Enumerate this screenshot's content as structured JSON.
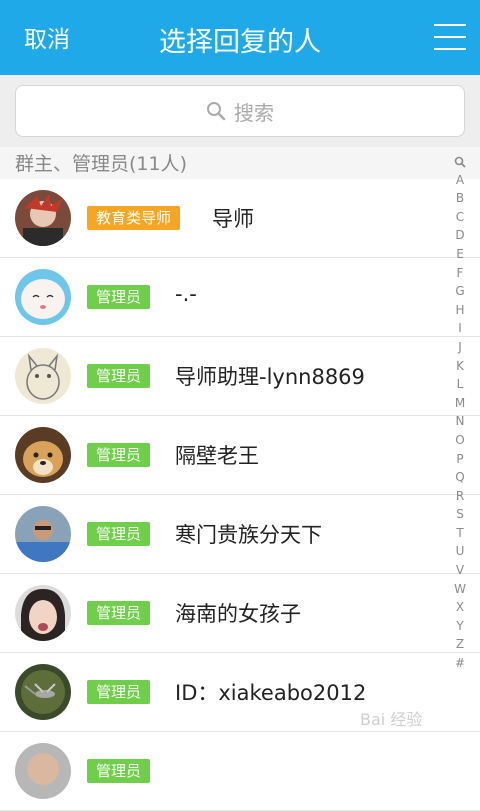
{
  "header": {
    "cancel_label": "取消",
    "title": "选择回复的人",
    "menu_icon": "menu-icon"
  },
  "search": {
    "placeholder": "搜索",
    "icon": "search-icon"
  },
  "section": {
    "title": "群主、管理员(11人)"
  },
  "members": [
    {
      "badge": "教育类导师",
      "badge_type": "teacher",
      "name": "导师"
    },
    {
      "badge": "管理员",
      "badge_type": "admin",
      "name": "-.-"
    },
    {
      "badge": "管理员",
      "badge_type": "admin",
      "name": "导师助理-lynn8869"
    },
    {
      "badge": "管理员",
      "badge_type": "admin",
      "name": "隔壁老王"
    },
    {
      "badge": "管理员",
      "badge_type": "admin",
      "name": "寒门贵族分天下"
    },
    {
      "badge": "管理员",
      "badge_type": "admin",
      "name": "海南的女孩子"
    },
    {
      "badge": "管理员",
      "badge_type": "admin",
      "name": "ID：xiakeabo2012"
    },
    {
      "badge": "管理员",
      "badge_type": "admin",
      "name": ""
    }
  ],
  "index": [
    "A",
    "B",
    "C",
    "D",
    "E",
    "F",
    "G",
    "H",
    "I",
    "J",
    "K",
    "L",
    "M",
    "N",
    "O",
    "P",
    "Q",
    "R",
    "S",
    "T",
    "U",
    "V",
    "W",
    "X",
    "Y",
    "Z",
    "#"
  ],
  "watermark": "Bai 经验",
  "colors": {
    "accent": "#1fa9e8",
    "admin_badge": "#6fcf4a",
    "teacher_badge": "#f6a623"
  }
}
